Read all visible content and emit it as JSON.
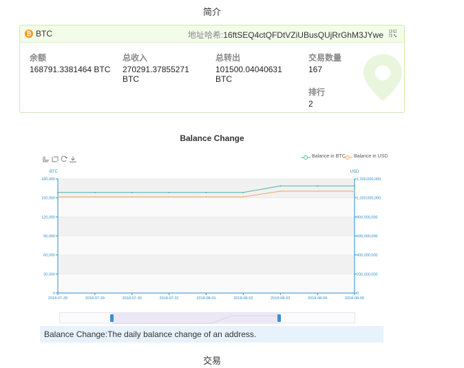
{
  "summary": {
    "title": "简介",
    "coin": "BTC",
    "coin_icon": "bitcoin-icon",
    "address_label": "地址哈希:",
    "address": "16ftSEQ4ctQFDtVZiUBusQUjRrGhM3JYwe",
    "stats": [
      {
        "label": "余额",
        "value": "168791.3381464 BTC"
      },
      {
        "label": "总收入",
        "value": "270291.37855271 BTC"
      },
      {
        "label": "总转出",
        "value": "101500.04040631 BTC"
      },
      {
        "label": "交易数量",
        "value": "167"
      },
      {
        "label": "排行",
        "value": "2"
      }
    ]
  },
  "chart_section": {
    "title": "Balance Change",
    "description": "Balance Change:The daily balance change of an address."
  },
  "transactions": {
    "title": "交易"
  },
  "colors": {
    "btc_line": "#4fb3a4",
    "usd_line": "#f5a25d",
    "axis": "#2a8fcf",
    "accent": "#9fd36b"
  },
  "chart_data": {
    "type": "line",
    "title": "",
    "x": [
      "2018-07-28",
      "2018-07-29",
      "2018-07-30",
      "2018-07-31",
      "2018-08-01",
      "2018-08-02",
      "2018-08-03",
      "2018-08-04",
      "2018-08-05"
    ],
    "series": [
      {
        "name": "Balance in BTC",
        "axis": "left",
        "values": [
          158500,
          158500,
          158500,
          158500,
          158500,
          158500,
          168791,
          168791,
          168791
        ]
      },
      {
        "name": "Balance in USD",
        "axis": "right",
        "values": [
          1010000000,
          1010000000,
          1010000000,
          1010000000,
          1010000000,
          1010000000,
          1070000000,
          1070000000,
          1070000000
        ]
      }
    ],
    "y_left": {
      "label": "BTC",
      "range": [
        0,
        180000
      ],
      "ticks": [
        "0",
        "30,000",
        "60,000",
        "90,000",
        "120,000",
        "150,000",
        "180,000"
      ]
    },
    "y_right": {
      "label": "USD",
      "range": [
        0,
        1200000000
      ],
      "ticks": [
        "0",
        "200,000,000",
        "400,000,000",
        "600,000,000",
        "800,000,000",
        "1,000,000,000",
        "1,200,000,000"
      ]
    },
    "legend_position": "top-right",
    "grid": true
  }
}
